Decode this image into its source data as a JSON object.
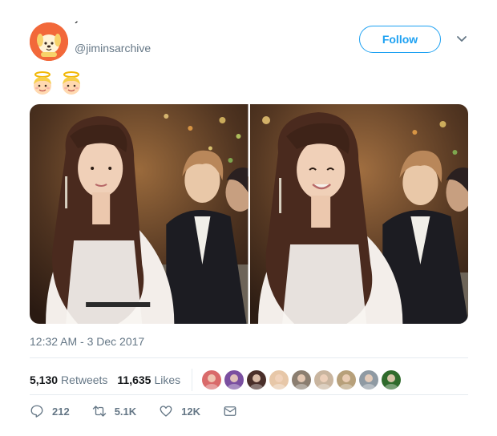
{
  "tweet": {
    "display_name": "´",
    "handle": "@jiminsarchive",
    "follow_label": "Follow",
    "emojis": [
      "angel-face-emoji",
      "angel-face-emoji"
    ],
    "timestamp": "12:32 AM - 3 Dec 2017",
    "stats": {
      "retweets_count": "5,130",
      "retweets_label": "Retweets",
      "likes_count": "11,635",
      "likes_label": "Likes"
    },
    "liker_avatars": [
      "#d96a6a",
      "#7a4fa0",
      "#4a2f2a",
      "#e7c7a8",
      "#8b7e70",
      "#c9b59f",
      "#b7a07a",
      "#8f9aa3",
      "#2f6b2c"
    ],
    "actions": {
      "reply_count": "212",
      "retweet_count": "5.1K",
      "like_count": "12K"
    }
  },
  "colors": {
    "accent": "#1da1f2",
    "muted_text": "#657786",
    "divider": "#e6ecf0",
    "avatar_bg": "#f2683a"
  }
}
